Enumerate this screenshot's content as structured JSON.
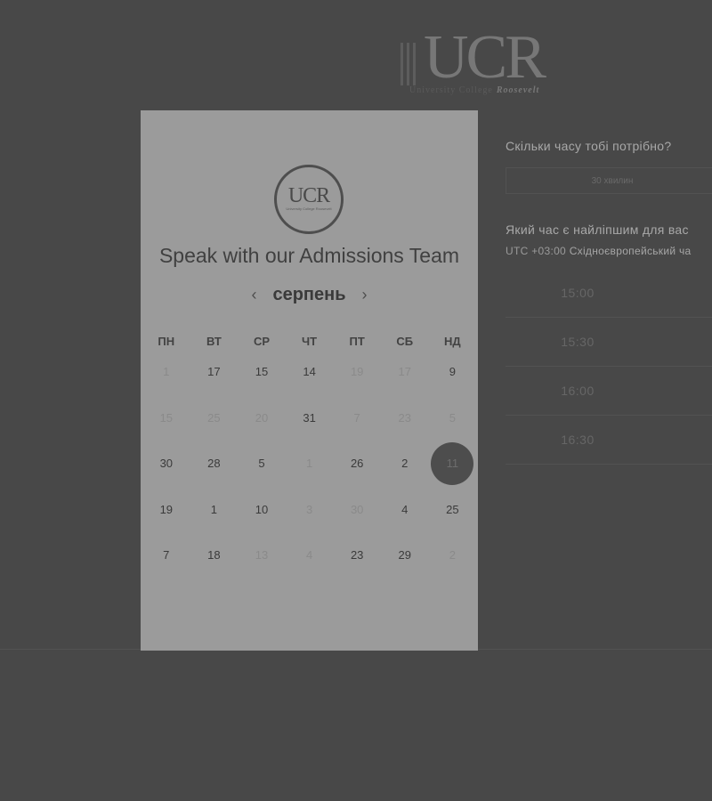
{
  "header": {
    "logo_letters": "UCR",
    "logo_sub_left": "University College",
    "logo_sub_right": "Roosevelt"
  },
  "card": {
    "logo_letters": "UCR",
    "logo_sub": "University College Roosevelt",
    "title": "Speak with our Admissions Team",
    "month": "серпень",
    "prev_icon": "‹",
    "next_icon": "›",
    "weekdays": [
      "ПН",
      "ВТ",
      "СР",
      "ЧТ",
      "ПТ",
      "СБ",
      "НД"
    ],
    "days": [
      {
        "n": "1",
        "disabled": true
      },
      {
        "n": "17"
      },
      {
        "n": "15"
      },
      {
        "n": "14"
      },
      {
        "n": "19",
        "disabled": true
      },
      {
        "n": "17",
        "disabled": true
      },
      {
        "n": "9"
      },
      {
        "n": "15",
        "disabled": true
      },
      {
        "n": "25",
        "disabled": true
      },
      {
        "n": "20",
        "disabled": true
      },
      {
        "n": "31"
      },
      {
        "n": "7",
        "disabled": true
      },
      {
        "n": "23",
        "disabled": true
      },
      {
        "n": "5",
        "disabled": true
      },
      {
        "n": "30"
      },
      {
        "n": "28"
      },
      {
        "n": "5"
      },
      {
        "n": "1",
        "disabled": true
      },
      {
        "n": "26"
      },
      {
        "n": "2"
      },
      {
        "n": "11",
        "selected": true
      },
      {
        "n": "19"
      },
      {
        "n": "1"
      },
      {
        "n": "10"
      },
      {
        "n": "3",
        "disabled": true
      },
      {
        "n": "30",
        "disabled": true
      },
      {
        "n": "4"
      },
      {
        "n": "25"
      },
      {
        "n": "7"
      },
      {
        "n": "18"
      },
      {
        "n": "13",
        "disabled": true
      },
      {
        "n": "4",
        "disabled": true
      },
      {
        "n": "23"
      },
      {
        "n": "29"
      },
      {
        "n": "2",
        "disabled": true
      }
    ]
  },
  "right": {
    "duration_question": "Скільки часу тобі потрібно?",
    "duration_value": "30 хвилин",
    "time_question": "Який час є найліпшим для вас",
    "tz_offset": "UTC +03:00",
    "tz_name": "Східноєвропейський ча",
    "slots": [
      "15:00",
      "15:30",
      "16:00",
      "16:30"
    ]
  }
}
